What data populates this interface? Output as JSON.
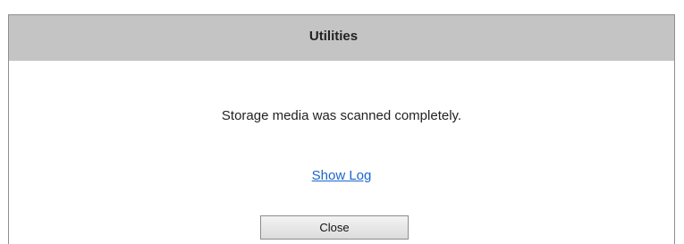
{
  "dialog": {
    "title": "Utilities",
    "message": "Storage media was scanned completely.",
    "show_log_link": "Show Log",
    "close_button": "Close"
  },
  "colors": {
    "titlebar_bg": "#c4c4c4",
    "link": "#1a66cc"
  }
}
